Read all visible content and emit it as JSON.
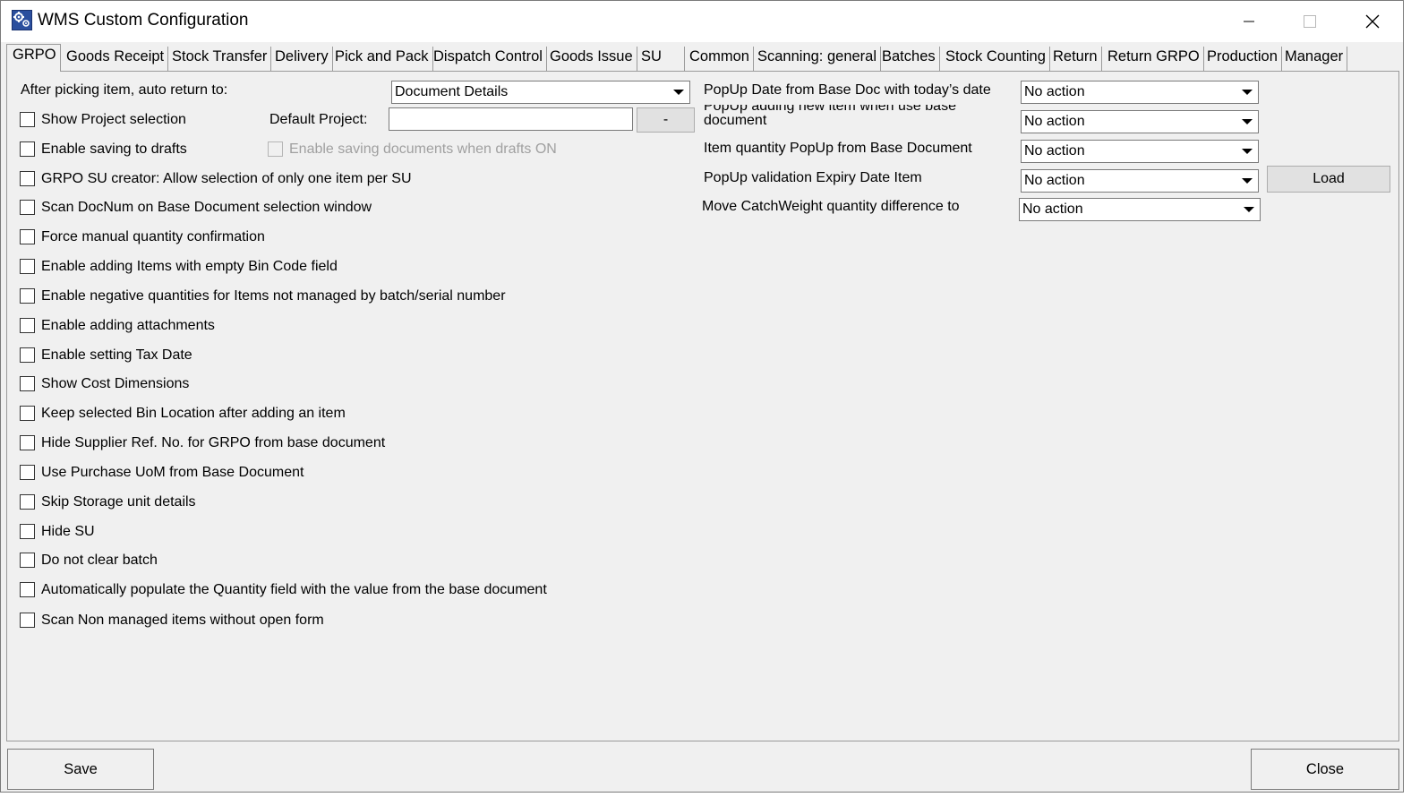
{
  "window": {
    "title": "WMS Custom Configuration"
  },
  "tabs": [
    {
      "label": "GRPO",
      "active": true
    },
    {
      "label": "Goods Receipt"
    },
    {
      "label": "Stock Transfer"
    },
    {
      "label": "Delivery"
    },
    {
      "label": "Pick and Pack"
    },
    {
      "label": "Dispatch Control"
    },
    {
      "label": "Goods Issue"
    },
    {
      "label": "SU"
    },
    {
      "label": "Common"
    },
    {
      "label": "Scanning: general"
    },
    {
      "label": "Batches"
    },
    {
      "label": "Stock Counting"
    },
    {
      "label": "Return"
    },
    {
      "label": "Return GRPO"
    },
    {
      "label": "Production"
    },
    {
      "label": "Manager"
    }
  ],
  "left": {
    "auto_return_label": "After picking item, auto return to:",
    "auto_return_value": "Document Details",
    "default_project_label": "Default Project:",
    "default_project_value": "",
    "default_project_button": "-",
    "drafts_docs_label": "Enable saving documents when drafts ON",
    "checkboxes": [
      {
        "label": "Show Project selection",
        "checked": false
      },
      {
        "label": "Enable saving to drafts",
        "checked": false
      },
      {
        "label": "GRPO SU creator: Allow selection of only one item per SU",
        "checked": false
      },
      {
        "label": "Scan DocNum on Base Document selection window",
        "checked": false
      },
      {
        "label": "Force manual quantity confirmation",
        "checked": false
      },
      {
        "label": "Enable adding Items with empty Bin Code field",
        "checked": false
      },
      {
        "label": "Enable negative quantities for Items not managed by batch/serial number",
        "checked": false
      },
      {
        "label": "Enable adding attachments",
        "checked": false
      },
      {
        "label": "Enable setting Tax Date",
        "checked": false
      },
      {
        "label": "Show Cost Dimensions",
        "checked": false
      },
      {
        "label": "Keep selected Bin Location after adding an item",
        "checked": false
      },
      {
        "label": "Hide Supplier Ref. No. for GRPO from base document",
        "checked": false
      },
      {
        "label": "Use Purchase UoM from Base Document",
        "checked": false
      },
      {
        "label": "Skip Storage unit details",
        "checked": false
      },
      {
        "label": "Hide SU",
        "checked": false
      },
      {
        "label": "Do not clear batch",
        "checked": false
      },
      {
        "label": "Automatically populate the Quantity field with the value from the base document",
        "checked": false
      },
      {
        "label": "Scan Non managed items without open form",
        "checked": false
      }
    ]
  },
  "right": {
    "rows": [
      {
        "label": "PopUp Date from Base Doc with today’s date",
        "value": "No action"
      },
      {
        "label": "PopUp adding new item when use base document",
        "value": "No action"
      },
      {
        "label": "Item quantity PopUp from Base Document",
        "value": "No action"
      },
      {
        "label": "PopUp validation Expiry Date Item",
        "value": "No action"
      },
      {
        "label": "Move CatchWeight quantity difference to",
        "value": "No action"
      }
    ],
    "load_button": "Load"
  },
  "footer": {
    "save": "Save",
    "close": "Close"
  }
}
